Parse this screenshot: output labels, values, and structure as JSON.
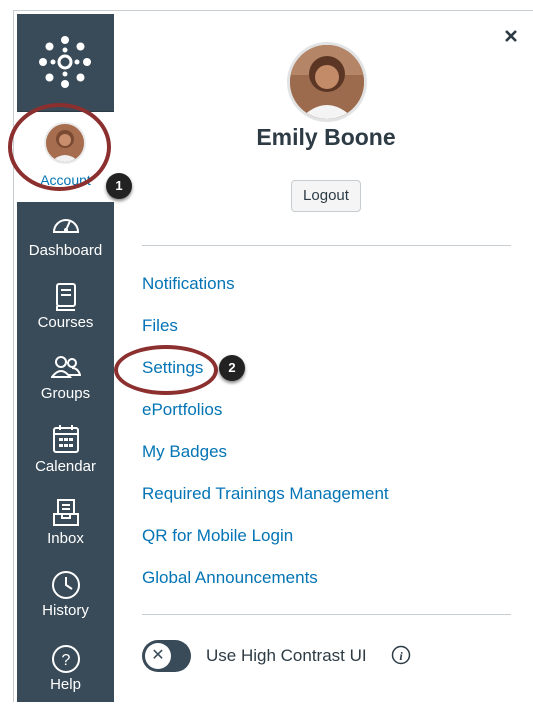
{
  "nav": {
    "account_label": "Account",
    "items": [
      {
        "label": "Dashboard",
        "icon": "dashboard-icon"
      },
      {
        "label": "Courses",
        "icon": "courses-icon"
      },
      {
        "label": "Groups",
        "icon": "groups-icon"
      },
      {
        "label": "Calendar",
        "icon": "calendar-icon"
      },
      {
        "label": "Inbox",
        "icon": "inbox-icon"
      },
      {
        "label": "History",
        "icon": "history-icon"
      },
      {
        "label": "Help",
        "icon": "help-icon"
      }
    ]
  },
  "tray": {
    "close_icon": "close-icon",
    "user_name": "Emily Boone",
    "logout_label": "Logout",
    "links": [
      "Notifications",
      "Files",
      "Settings",
      "ePortfolios",
      "My Badges",
      "Required Trainings Management",
      "QR for Mobile Login",
      "Global Announcements"
    ],
    "high_contrast_label": "Use High Contrast UI",
    "toggle_glyph": "✕"
  },
  "annotations": {
    "badge_1": "1",
    "badge_2": "2"
  },
  "colors": {
    "nav_bg": "#394b58",
    "link": "#0374b5",
    "annotation": "#8c2f2f"
  }
}
